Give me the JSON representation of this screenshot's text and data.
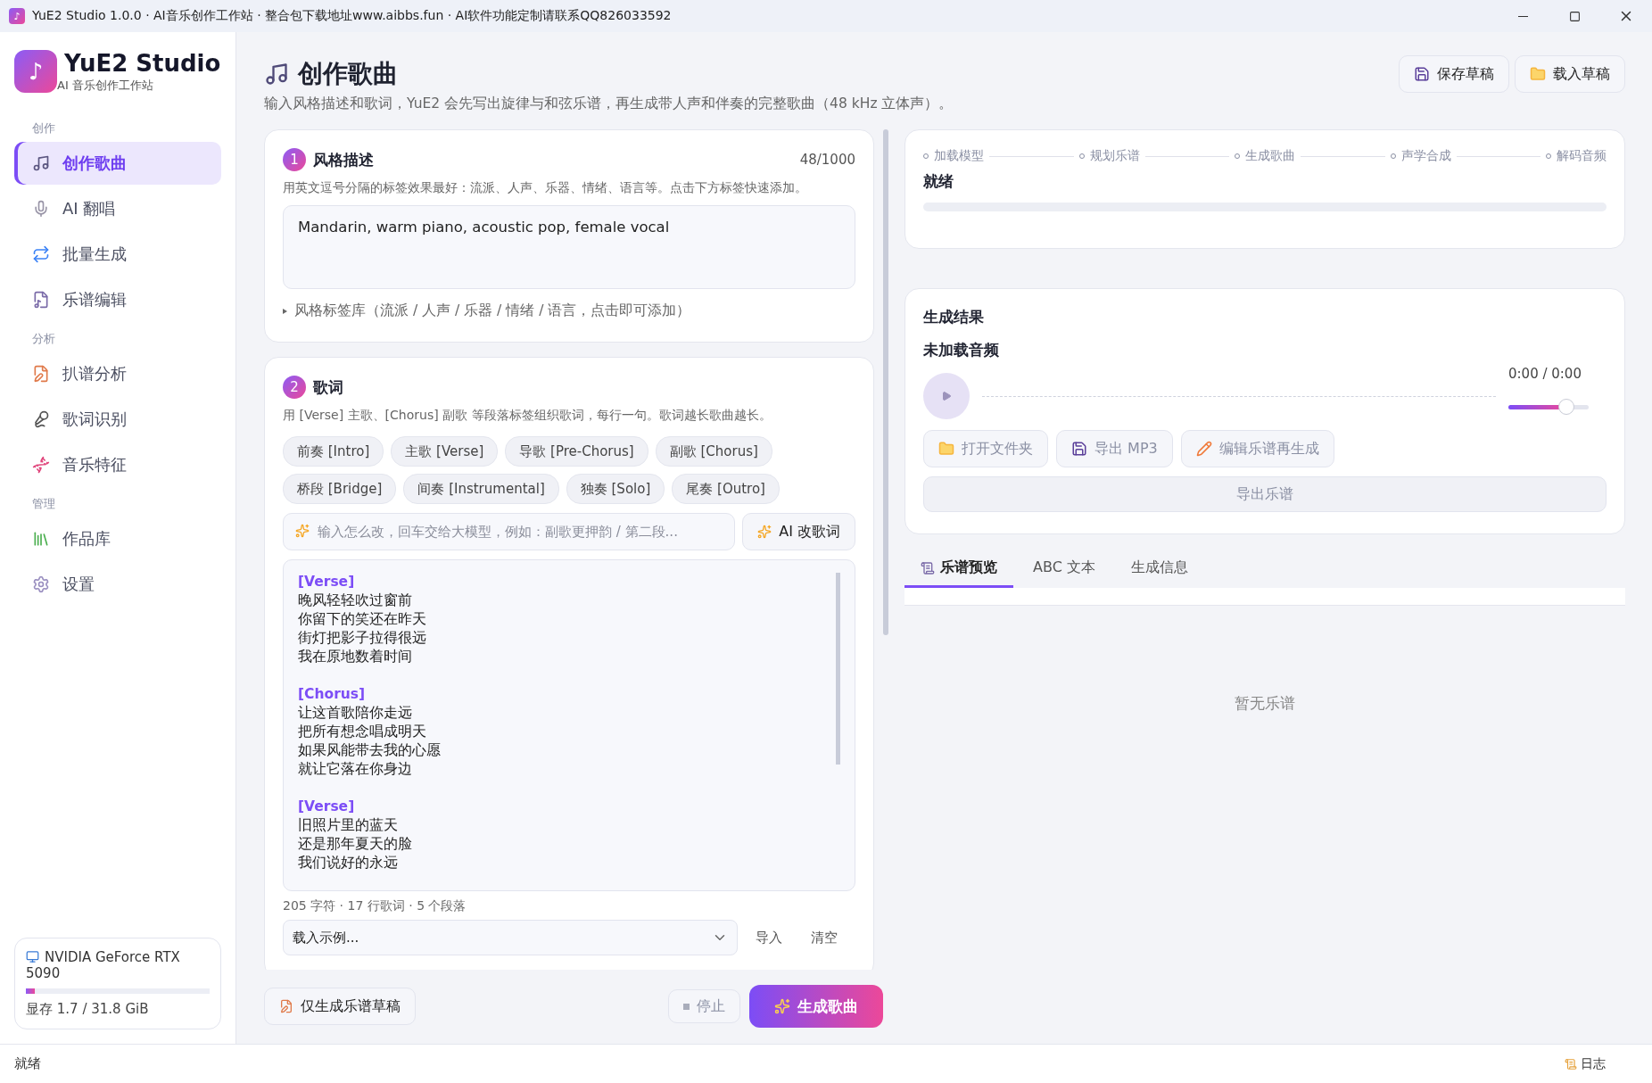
{
  "window": {
    "title": "YuE2 Studio 1.0.0 · AI音乐创作工作站 · 整合包下载地址www.aibbs.fun · AI软件功能定制请联系QQ826033592"
  },
  "sidebar": {
    "logo_glyph": "♪",
    "app_name": "YuE2 Studio",
    "app_subtitle": "AI 音乐创作工作站",
    "groups": [
      {
        "label": "创作",
        "items": [
          {
            "label": "创作歌曲",
            "selected": true
          },
          {
            "label": "AI 翻唱",
            "selected": false
          },
          {
            "label": "批量生成",
            "selected": false
          },
          {
            "label": "乐谱编辑",
            "selected": false
          }
        ]
      },
      {
        "label": "分析",
        "items": [
          {
            "label": "扒谱分析",
            "selected": false
          },
          {
            "label": "歌词识别",
            "selected": false
          },
          {
            "label": "音乐特征",
            "selected": false
          }
        ]
      },
      {
        "label": "管理",
        "items": [
          {
            "label": "作品库",
            "selected": false
          },
          {
            "label": "设置",
            "selected": false
          }
        ]
      }
    ],
    "gpu": {
      "name": "NVIDIA GeForce RTX 5090",
      "level": 0.05,
      "memory": "显存 1.7 / 31.8 GiB"
    }
  },
  "header": {
    "title": "创作歌曲",
    "subtitle": "输入风格描述和歌词，YuE2 会先写出旋律与和弦乐谱，再生成带人声和伴奏的完整歌曲（48 kHz 立体声）。",
    "buttons": [
      "保存草稿",
      "载入草稿"
    ]
  },
  "style_card": {
    "number": "1",
    "title": "风格描述",
    "count": "48/1000",
    "hint": "用英文逗号分隔的标签效果最好：流派、人声、乐器、情绪、语言等。点击下方标签快速添加。",
    "value": "Mandarin, warm piano, acoustic pop, female vocal",
    "library": "风格标签库（流派 / 人声 / 乐器 / 情绪 / 语言，点击即可添加）"
  },
  "lyrics_card": {
    "number": "2",
    "title": "歌词",
    "hint": "用 [Verse] 主歌、[Chorus] 副歌 等段落标签组织歌词，每行一句。歌词越长歌曲越长。",
    "chips": [
      "前奏 [Intro]",
      "主歌 [Verse]",
      "导歌 [Pre-Chorus]",
      "副歌 [Chorus]",
      "桥段 [Bridge]",
      "间奏 [Instrumental]",
      "独奏 [Solo]",
      "尾奏 [Outro]"
    ],
    "ai_placeholder": "输入怎么改，回车交给大模型，例如：副歌更押韵 / 第二段...",
    "ai_button": "AI 改歌词",
    "sections": [
      {
        "tag": "[Verse]",
        "lines": [
          "晚风轻轻吹过窗前",
          "你留下的笑还在昨天",
          "街灯把影子拉得很远",
          "我在原地数着时间"
        ]
      },
      {
        "tag": "[Chorus]",
        "lines": [
          "让这首歌陪你走远",
          "把所有想念唱成明天",
          "如果风能带去我的心愿",
          "就让它落在你身边"
        ]
      },
      {
        "tag": "[Verse]",
        "lines": [
          "旧照片里的蓝天",
          "还是那年夏天的脸",
          "我们说好的永远"
        ]
      }
    ],
    "stats": "205 字符 · 17 行歌词 · 5 个段落",
    "example_select": "载入示例...",
    "import": "导入",
    "clear": "清空"
  },
  "actions": {
    "draft": "仅生成乐谱草稿",
    "stop": "停止",
    "stop_disabled": true,
    "generate": "生成歌曲"
  },
  "progress": {
    "steps": [
      "加载模型",
      "规划乐谱",
      "生成歌曲",
      "声学合成",
      "解码音频"
    ],
    "status": "就绪",
    "level": 0
  },
  "result": {
    "title": "生成结果",
    "audio_status": "未加载音频",
    "time": "0:00 / 0:00",
    "volume": {
      "level": 0.72
    },
    "buttons": [
      "打开文件夹",
      "导出 MP3",
      "编辑乐谱再生成"
    ],
    "export": "导出乐谱"
  },
  "preview_tabs": [
    {
      "label": "乐谱预览",
      "selected": true
    },
    {
      "label": "ABC 文本",
      "selected": false
    },
    {
      "label": "生成信息",
      "selected": false
    }
  ],
  "preview_empty": "暂无乐谱",
  "status_bar": {
    "text": "就绪",
    "log": "日志"
  }
}
